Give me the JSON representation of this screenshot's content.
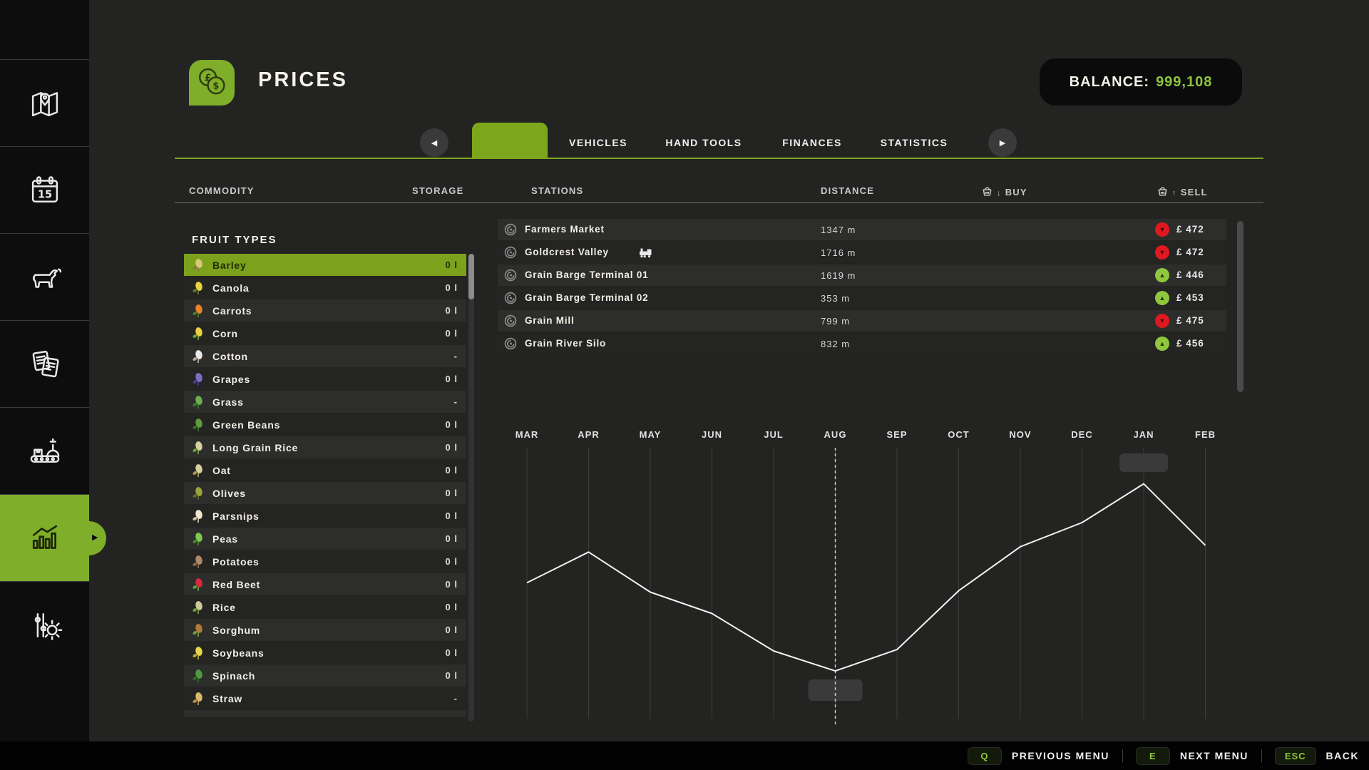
{
  "colors": {
    "accent_green": "#7ca71c",
    "text_green": "#8dc63f",
    "badge_red": "#e0191f",
    "badge_green": "#8fc73e"
  },
  "sidebar": {
    "caret": "▶",
    "calendar_day": "15",
    "items": [
      {
        "icon": "map-icon",
        "selected": false
      },
      {
        "icon": "calendar-icon",
        "selected": false
      },
      {
        "icon": "animals-icon",
        "selected": false
      },
      {
        "icon": "contracts-icon",
        "selected": false
      },
      {
        "icon": "production-icon",
        "selected": false
      },
      {
        "icon": "prices-statistics-icon",
        "selected": true
      },
      {
        "icon": "settings-sliders-icon",
        "selected": false
      }
    ]
  },
  "header": {
    "title": "PRICES",
    "title_icon": "coins-icon",
    "coin_symbols": [
      "£",
      "$"
    ],
    "balance_label": "BALANCE:",
    "balance_value": "999,108"
  },
  "tabs": {
    "prev": "◀",
    "next": "▶",
    "selected_label": "",
    "items": [
      "VEHICLES",
      "HAND TOOLS",
      "FINANCES",
      "STATISTICS"
    ]
  },
  "table_headers": {
    "commodity": "COMMODITY",
    "storage": "STORAGE",
    "stations": "STATIONS",
    "distance": "DISTANCE",
    "buy": "BUY",
    "sell": "SELL",
    "buy_arrow": "↓",
    "sell_arrow": "↑"
  },
  "commodities": {
    "group_label": "FRUIT TYPES",
    "items": [
      {
        "label": "Barley",
        "storage": "0 l",
        "selected": true,
        "icon_main": "#d9c878",
        "icon_accent": "#8a7a3a"
      },
      {
        "label": "Canola",
        "storage": "0 l",
        "selected": false,
        "icon_main": "#e8d33f",
        "icon_accent": "#5d7a2f"
      },
      {
        "label": "Carrots",
        "storage": "0 l",
        "selected": false,
        "icon_main": "#e8822d",
        "icon_accent": "#4f7a2f"
      },
      {
        "label": "Corn",
        "storage": "0 l",
        "selected": false,
        "icon_main": "#eecf3e",
        "icon_accent": "#6fa03a"
      },
      {
        "label": "Cotton",
        "storage": "-",
        "selected": false,
        "icon_main": "#e9e9e9",
        "icon_accent": "#b9a999"
      },
      {
        "label": "Grapes",
        "storage": "0 l",
        "selected": false,
        "icon_main": "#7a6fc0",
        "icon_accent": "#4a3f8f"
      },
      {
        "label": "Grass",
        "storage": "-",
        "selected": false,
        "icon_main": "#6fae4e",
        "icon_accent": "#3f7a2f"
      },
      {
        "label": "Green Beans",
        "storage": "0 l",
        "selected": false,
        "icon_main": "#5d9c3f",
        "icon_accent": "#3a6e28"
      },
      {
        "label": "Long Grain Rice",
        "storage": "0 l",
        "selected": false,
        "icon_main": "#d8cf9f",
        "icon_accent": "#6fa03a"
      },
      {
        "label": "Oat",
        "storage": "0 l",
        "selected": false,
        "icon_main": "#d9cf9a",
        "icon_accent": "#a89a5f"
      },
      {
        "label": "Olives",
        "storage": "0 l",
        "selected": false,
        "icon_main": "#9aa43f",
        "icon_accent": "#5f6e28"
      },
      {
        "label": "Parsnips",
        "storage": "0 l",
        "selected": false,
        "icon_main": "#efe8d0",
        "icon_accent": "#cfc3a0"
      },
      {
        "label": "Peas",
        "storage": "0 l",
        "selected": false,
        "icon_main": "#7ec850",
        "icon_accent": "#4a8a2f"
      },
      {
        "label": "Potatoes",
        "storage": "0 l",
        "selected": false,
        "icon_main": "#b08968",
        "icon_accent": "#8a6a4a"
      },
      {
        "label": "Red Beet",
        "storage": "0 l",
        "selected": false,
        "icon_main": "#d8283f",
        "icon_accent": "#5d9c3f"
      },
      {
        "label": "Rice",
        "storage": "0 l",
        "selected": false,
        "icon_main": "#cfc89a",
        "icon_accent": "#6fa03a"
      },
      {
        "label": "Sorghum",
        "storage": "0 l",
        "selected": false,
        "icon_main": "#b07a3a",
        "icon_accent": "#6fa03a"
      },
      {
        "label": "Soybeans",
        "storage": "0 l",
        "selected": false,
        "icon_main": "#e8d44d",
        "icon_accent": "#b8a42f"
      },
      {
        "label": "Spinach",
        "storage": "0 l",
        "selected": false,
        "icon_main": "#4e9a3f",
        "icon_accent": "#2f6e28"
      },
      {
        "label": "Straw",
        "storage": "-",
        "selected": false,
        "icon_main": "#d9b96a",
        "icon_accent": "#b8924a"
      }
    ]
  },
  "stations": {
    "rows": [
      {
        "name": "Farmers Market",
        "train": false,
        "distance": "1347 m",
        "trend": "down",
        "price": "£ 472"
      },
      {
        "name": "Goldcrest Valley",
        "train": true,
        "distance": "1716 m",
        "trend": "down",
        "price": "£ 472"
      },
      {
        "name": "Grain Barge Terminal 01",
        "train": false,
        "distance": "1619 m",
        "trend": "up",
        "price": "£ 446"
      },
      {
        "name": "Grain Barge Terminal 02",
        "train": false,
        "distance": "353 m",
        "trend": "up",
        "price": "£ 453"
      },
      {
        "name": "Grain Mill",
        "train": false,
        "distance": "799 m",
        "trend": "down",
        "price": "£ 475"
      },
      {
        "name": "Grain River Silo",
        "train": false,
        "distance": "832 m",
        "trend": "up",
        "price": "£ 456"
      }
    ]
  },
  "chart_data": {
    "type": "line",
    "categories": [
      "MAR",
      "APR",
      "MAY",
      "JUN",
      "JUL",
      "AUG",
      "SEP",
      "OCT",
      "NOV",
      "DEC",
      "JAN",
      "FEB"
    ],
    "series": [
      {
        "name": "sell-price-trend",
        "values_percent_of_plot_height": [
          49.5,
          61,
          46,
          38,
          24,
          16.5,
          24.5,
          46.5,
          63,
          72,
          86.5,
          63.5
        ]
      }
    ],
    "current_month_marker": "AUG",
    "min_month": "AUG",
    "max_month": "JAN",
    "empty_label_boxes": [
      {
        "month": "JAN",
        "position": "top"
      },
      {
        "month": "AUG",
        "position": "bottom"
      }
    ],
    "grid": "vertical-monthly",
    "legend": "none",
    "xlabel": "",
    "ylabel": "",
    "y_axis_labels_visible": false
  },
  "footer": {
    "separator": "|",
    "hints": [
      {
        "key": "Q",
        "label": "PREVIOUS MENU"
      },
      {
        "key": "E",
        "label": "NEXT MENU"
      },
      {
        "key": "ESC",
        "label": "BACK"
      }
    ]
  }
}
